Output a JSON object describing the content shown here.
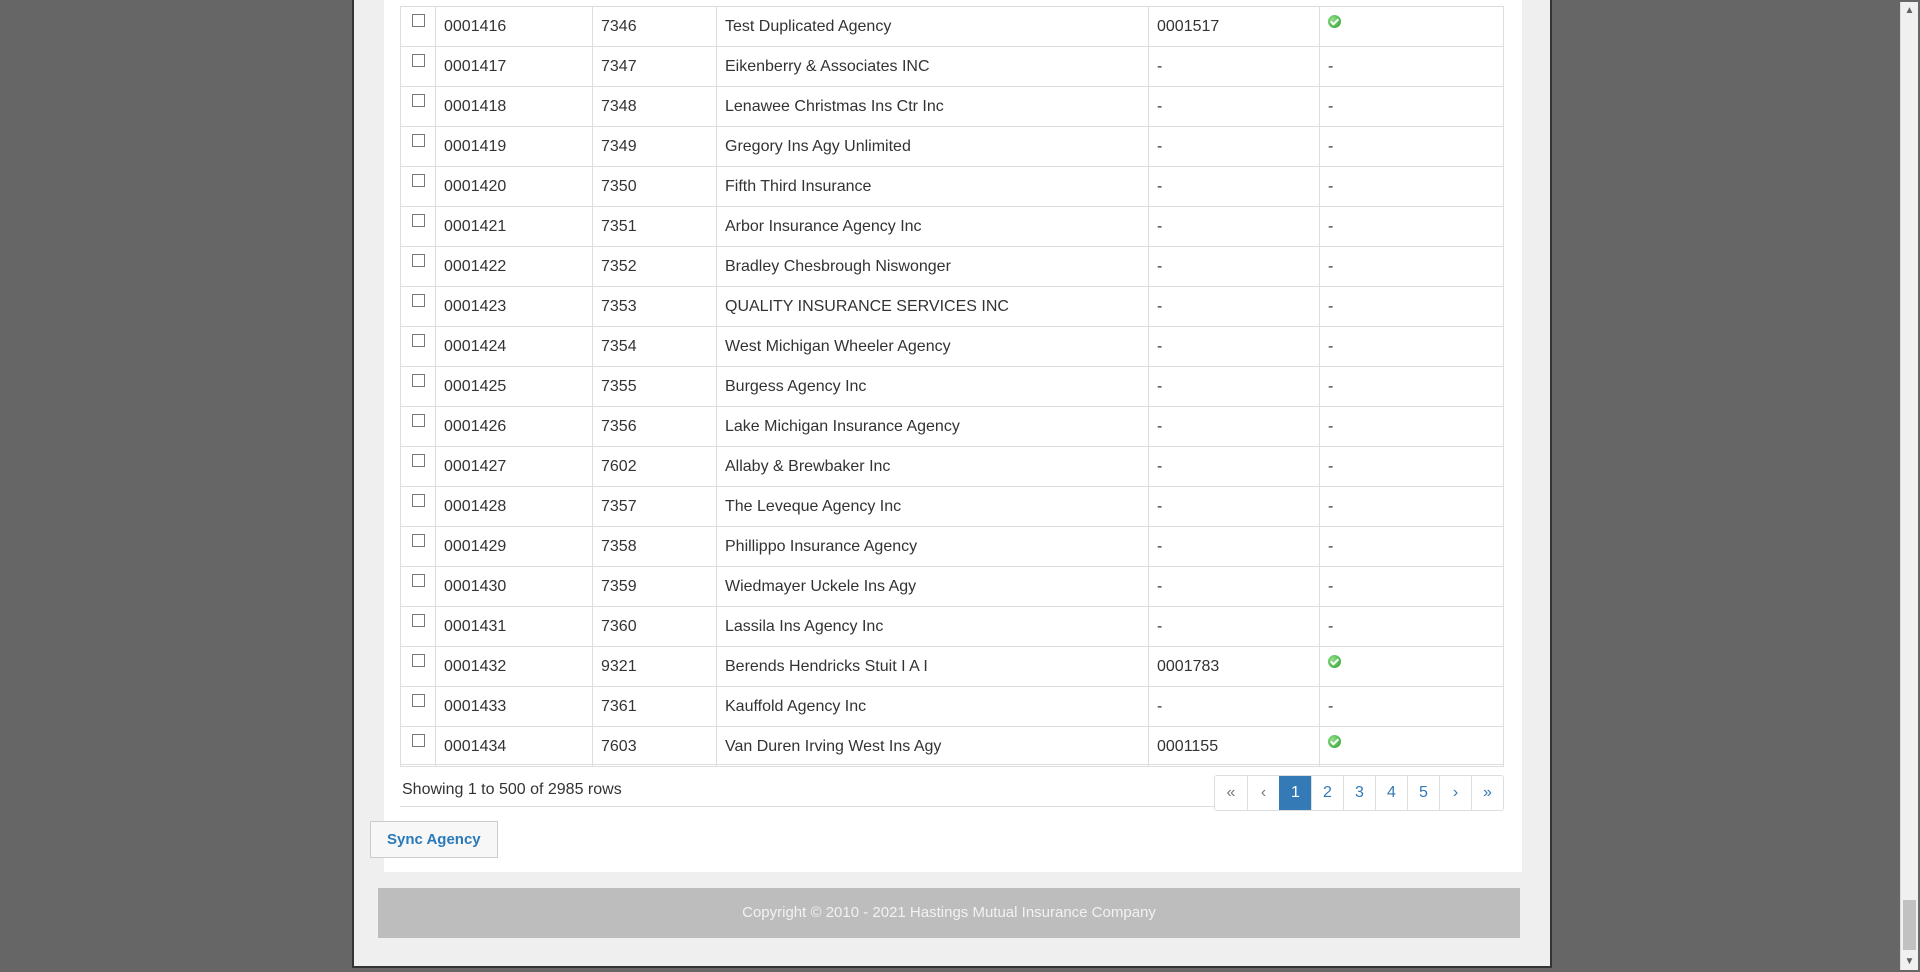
{
  "table": {
    "rows": [
      {
        "id": "0001416",
        "code": "7346",
        "name": "Test Duplicated Agency",
        "ext": "0001517",
        "status": "ok"
      },
      {
        "id": "0001417",
        "code": "7347",
        "name": "Eikenberry & Associates INC",
        "ext": "-",
        "status": "-"
      },
      {
        "id": "0001418",
        "code": "7348",
        "name": "Lenawee Christmas Ins Ctr Inc",
        "ext": "-",
        "status": "-"
      },
      {
        "id": "0001419",
        "code": "7349",
        "name": "Gregory Ins Agy Unlimited",
        "ext": "-",
        "status": "-"
      },
      {
        "id": "0001420",
        "code": "7350",
        "name": "Fifth Third Insurance",
        "ext": "-",
        "status": "-"
      },
      {
        "id": "0001421",
        "code": "7351",
        "name": "Arbor Insurance Agency Inc",
        "ext": "-",
        "status": "-"
      },
      {
        "id": "0001422",
        "code": "7352",
        "name": "Bradley Chesbrough Niswonger",
        "ext": "-",
        "status": "-"
      },
      {
        "id": "0001423",
        "code": "7353",
        "name": "QUALITY INSURANCE SERVICES INC",
        "ext": "-",
        "status": "-"
      },
      {
        "id": "0001424",
        "code": "7354",
        "name": "West Michigan Wheeler Agency",
        "ext": "-",
        "status": "-"
      },
      {
        "id": "0001425",
        "code": "7355",
        "name": "Burgess Agency Inc",
        "ext": "-",
        "status": "-"
      },
      {
        "id": "0001426",
        "code": "7356",
        "name": "Lake Michigan Insurance Agency",
        "ext": "-",
        "status": "-"
      },
      {
        "id": "0001427",
        "code": "7602",
        "name": "Allaby & Brewbaker Inc",
        "ext": "-",
        "status": "-"
      },
      {
        "id": "0001428",
        "code": "7357",
        "name": "The Leveque Agency Inc",
        "ext": "-",
        "status": "-"
      },
      {
        "id": "0001429",
        "code": "7358",
        "name": "Phillippo Insurance Agency",
        "ext": "-",
        "status": "-"
      },
      {
        "id": "0001430",
        "code": "7359",
        "name": "Wiedmayer Uckele Ins Agy",
        "ext": "-",
        "status": "-"
      },
      {
        "id": "0001431",
        "code": "7360",
        "name": "Lassila Ins Agency Inc",
        "ext": "-",
        "status": "-"
      },
      {
        "id": "0001432",
        "code": "9321",
        "name": "Berends Hendricks Stuit I A I",
        "ext": "0001783",
        "status": "ok"
      },
      {
        "id": "0001433",
        "code": "7361",
        "name": "Kauffold Agency Inc",
        "ext": "-",
        "status": "-"
      },
      {
        "id": "0001434",
        "code": "7603",
        "name": "Van Duren Irving West Ins Agy",
        "ext": "0001155",
        "status": "ok"
      }
    ]
  },
  "pagination": {
    "info": "Showing 1 to 500 of 2985 rows",
    "first": "«",
    "prev": "‹",
    "pages": [
      "1",
      "2",
      "3",
      "4",
      "5"
    ],
    "active_page": "1",
    "next": "›",
    "last": "»"
  },
  "actions": {
    "sync_label": "Sync Agency"
  },
  "footer": {
    "copyright": "Copyright © 2010 - 2021 Hastings Mutual Insurance Company"
  },
  "icons": {
    "ok": "check-circle-icon",
    "row_select": "checkbox"
  },
  "colors": {
    "accent": "#337ab7",
    "ok": "#2e9d2a",
    "footer_bg": "#bdbdbd"
  }
}
